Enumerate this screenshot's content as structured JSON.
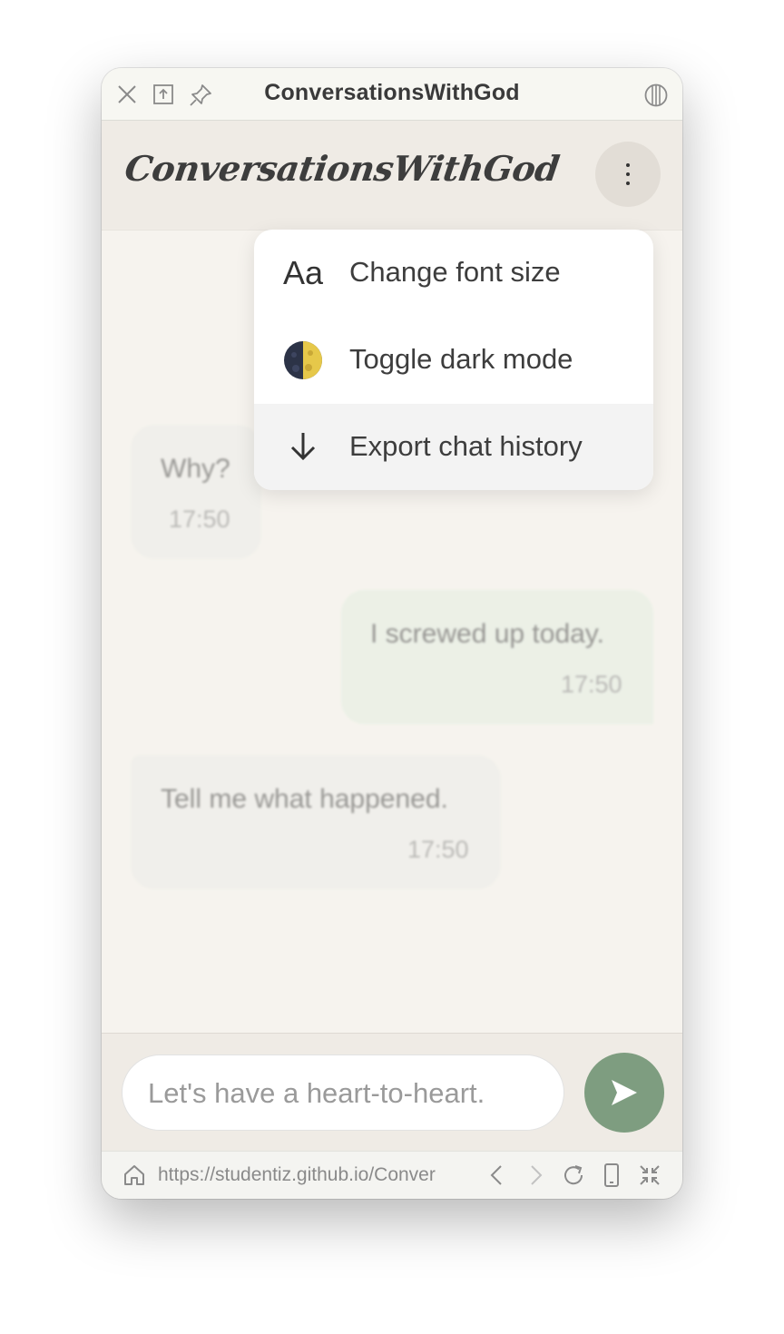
{
  "window": {
    "title": "ConversationsWithGod"
  },
  "titlebar_icons": [
    "close-icon",
    "share-icon",
    "pin-icon",
    "appearance-icon"
  ],
  "app": {
    "logo": "ConversationsWithGod",
    "menu_icon": "more-vertical-icon"
  },
  "menu": {
    "items": [
      {
        "icon": "Aa",
        "label": "Change font size"
      },
      {
        "icon": "🌗",
        "label": "Toggle dark mode"
      },
      {
        "icon": "↓",
        "label": "Export chat history"
      }
    ]
  },
  "messages": [
    {
      "from": "god",
      "text": "Why?",
      "time": "17:50"
    },
    {
      "from": "user",
      "text": "I screwed up today.",
      "time": "17:50"
    },
    {
      "from": "god",
      "text": "Tell me what happened.",
      "time": "17:50"
    }
  ],
  "composer": {
    "placeholder": "Let's have a heart-to-heart."
  },
  "browser": {
    "url": "https://studentiz.github.io/Conver"
  },
  "colors": {
    "send_button": "#7e9d80",
    "user_bubble": "#e3ede1",
    "god_bubble": "#ececea",
    "background": "#f6f3ee"
  }
}
